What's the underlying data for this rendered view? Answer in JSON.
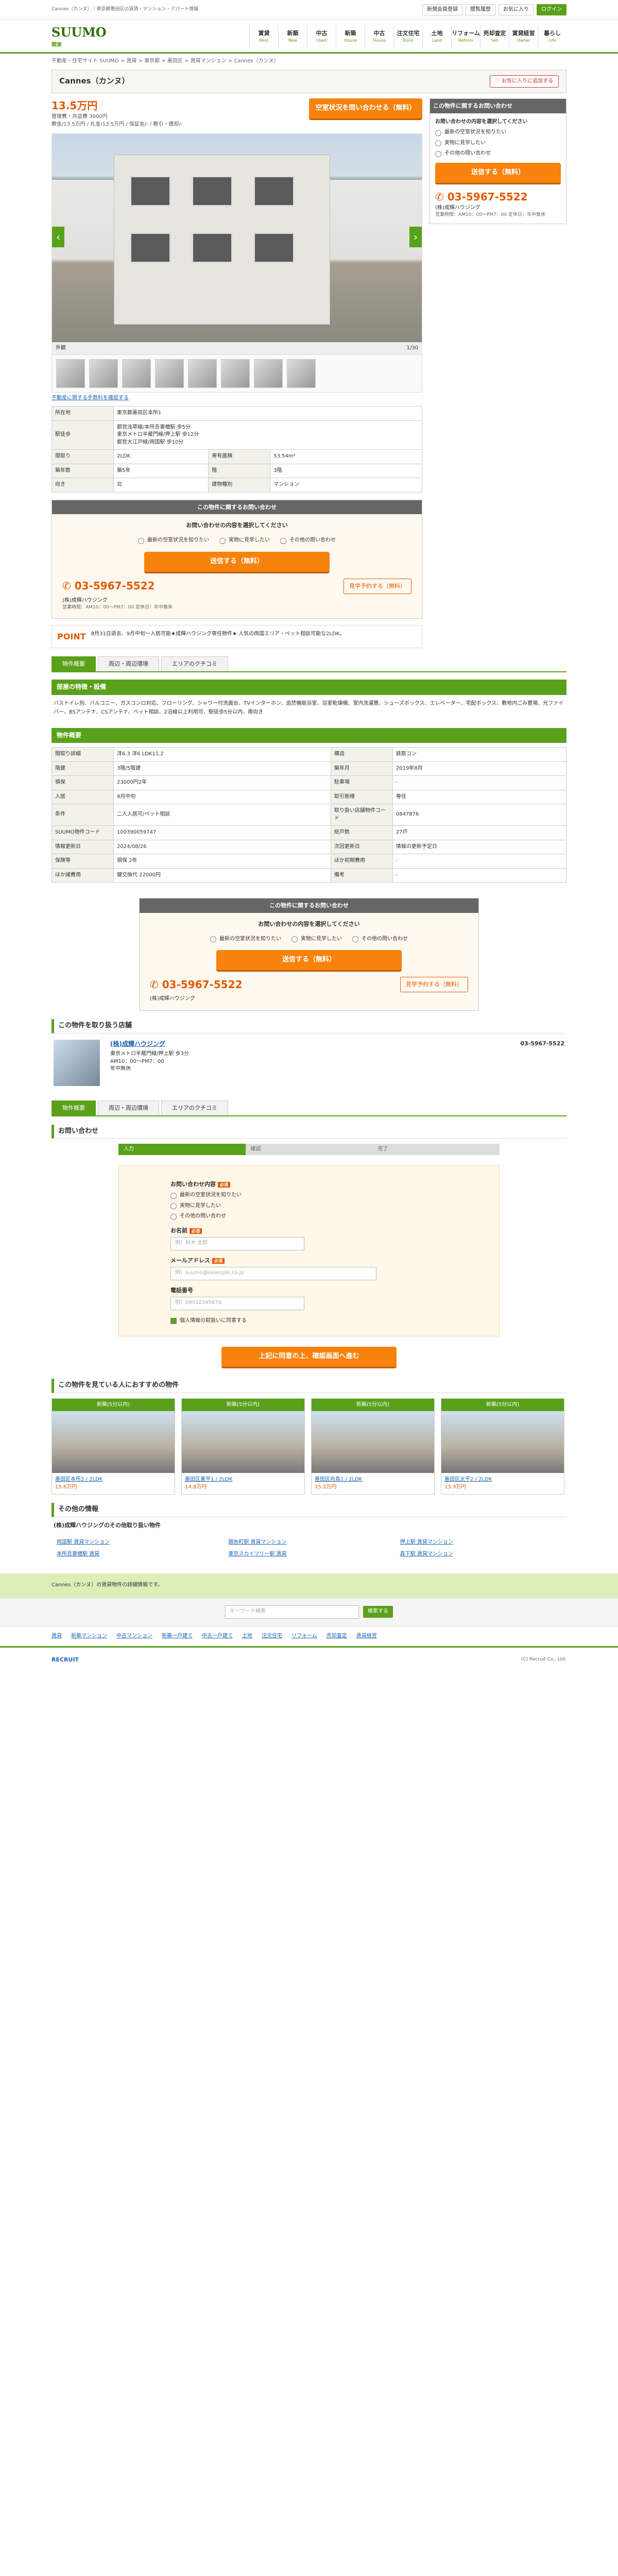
{
  "top": {
    "note": "Cannes（カンヌ）｜東京都墨田区の賃貸・マンション・アパート情報",
    "btns": [
      "新規会員登録",
      "ログイン",
      "閲覧履歴",
      "お気に入り",
      "メニュー"
    ]
  },
  "brand": {
    "name": "SUUMO",
    "region": "関東",
    "nav": [
      {
        "t": "賃貸",
        "s": "Rent"
      },
      {
        "t": "新築",
        "s": "New"
      },
      {
        "t": "中古",
        "s": "Used"
      },
      {
        "t": "新築",
        "s": "House"
      },
      {
        "t": "中古",
        "s": "House"
      },
      {
        "t": "注文住宅",
        "s": "Build"
      },
      {
        "t": "土地",
        "s": "Land"
      },
      {
        "t": "リフォーム",
        "s": "Reform"
      },
      {
        "t": "売却査定",
        "s": "Sell"
      },
      {
        "t": "賃貸経営",
        "s": "Owner"
      },
      {
        "t": "暮らし",
        "s": "Life"
      }
    ]
  },
  "breadcrumb": "不動産・住宅サイト SUUMO > 賃貸 > 東京都 > 墨田区 > 賃貸マンション > Cannes（カンヌ）",
  "title": "Cannes（カンヌ）",
  "fav_label": "お気に入りに追加する",
  "price": {
    "rent": "13.5万円",
    "fees": "管理費・共益費 3000円",
    "deposit": "敷金/13.5万円 / 礼金/13.5万円 / 保証金/- / 敷引・償却/-",
    "cta": "空室状況を問い合わせる（無料）"
  },
  "photo": {
    "caption": "外観",
    "count": "1/30"
  },
  "thumbs_note": "不動産に関する手数料を確認する",
  "details": [
    [
      "所在地",
      "東京都墨田区本所1"
    ],
    [
      "駅徒歩",
      "都営浅草線/本所吾妻橋駅 歩5分\n東京メトロ半蔵門線/押上駅 歩12分\n都営大江戸線/両国駅 歩10分"
    ],
    [
      "間取り",
      "2LDK"
    ],
    [
      "専有面積",
      "53.54m²"
    ],
    [
      "築年数",
      "築5年"
    ],
    [
      "階",
      "3階"
    ],
    [
      "向き",
      "北"
    ],
    [
      "建物種別",
      "マンション"
    ]
  ],
  "inquiry": {
    "head": "この物件に関するお問い合わせ",
    "prompt": "お問い合わせの内容を選択してください",
    "opts": [
      "最新の空室状況を知りたい",
      "実物に見学したい",
      "その他の問い合わせ"
    ],
    "send": "送信する（無料）",
    "tel": "03-5967-5522",
    "tel_btn": "見学予約する（無料）",
    "company": "(株)成輝ハウジング",
    "hours": "営業時間：AM10：00～PM7：00 定休日：年中無休"
  },
  "point": {
    "label": "POINT",
    "text": "8月31日退去、9月中旬〜入居可能★成輝ハウジング専任物件★ 人気の両国エリア・ペット相談可能な2LDK。"
  },
  "tabs": [
    "物件概要",
    "周辺・周辺環境",
    "エリアのクチコミ"
  ],
  "features": {
    "head": "部屋の特徴・設備",
    "text": "バストイレ別、バルコニー、ガスコンロ対応、フローリング、シャワー付洗面台、TVインターホン、追焚機能浴室、浴室乾燥機、室内洗濯置、シューズボックス、エレベーター、宅配ボックス、敷地内ごみ置場、光ファイバー、BSアンテナ、CSアンテナ、ペット相談、2沿線以上利用可、駅徒歩5分以内、南向き"
  },
  "overview": {
    "head": "物件概要",
    "rows": [
      [
        "間取り詳細",
        "洋6.3 洋6 LDK11.2",
        "構造",
        "鉄筋コン"
      ],
      [
        "階建",
        "3階/5階建",
        "築年月",
        "2019年8月"
      ],
      [
        "損保",
        "23000円2年",
        "駐車場",
        "-"
      ],
      [
        "入居",
        "9月中旬",
        "取引態様",
        "専任"
      ],
      [
        "条件",
        "二人入居可/ペット相談",
        "取り扱い店舗物件コード",
        "0847876"
      ],
      [
        "SUUMO物件コード",
        "100390059747",
        "総戸数",
        "27戸"
      ],
      [
        "情報更新日",
        "2024/08/26",
        "次回更新日",
        "情報の更新予定日"
      ],
      [
        "保険等",
        "損保 2年",
        "ほか初期費用",
        "-"
      ],
      [
        "ほか諸費用",
        "鍵交換代 22000円",
        "備考",
        "-"
      ]
    ]
  },
  "company_section": {
    "head": "この物件を取り扱う店舗",
    "name": "(株)成輝ハウジング",
    "addr": "東京メトロ半蔵門線/押上駅 歩3分",
    "hours": "AM10：00～PM7：00",
    "holiday": "年中無休",
    "tel": "03-5967-5522"
  },
  "form": {
    "head": "お問い合わせ",
    "steps": [
      "入力",
      "確認",
      "完了"
    ],
    "q": "お問い合わせ内容",
    "name_label": "お名前",
    "name_ph": "例）鈴木 太郎",
    "mail_label": "メールアドレス",
    "mail_ph": "例）suumo@example.co.jp",
    "tel_label": "電話番号",
    "tel_ph": "例）09012345678",
    "agree": "個人情報の取扱いに同意する",
    "submit": "上記に同意の上、確認画面へ進む"
  },
  "recs": {
    "head": "この物件を見ている人におすすめの物件",
    "items": [
      {
        "h": "新築(5分以内)",
        "n": "墨田区本所2 / 2LDK",
        "p": "15.6万円"
      },
      {
        "h": "新築(5分以内)",
        "n": "墨田区業平1 / 2LDK",
        "p": "14.8万円"
      },
      {
        "h": "新築(5分以内)",
        "n": "墨田区向島1 / 2LDK",
        "p": "15.2万円"
      },
      {
        "h": "新築(5分以内)",
        "n": "墨田区太平2 / 2LDK",
        "p": "13.9万円"
      }
    ]
  },
  "other": {
    "head": "その他の情報",
    "sub": "(株)成輝ハウジングのその他取り扱い物件",
    "links": [
      "両国駅 賃貸マンション",
      "錦糸町駅 賃貸マンション",
      "押上駅 賃貸マンション",
      "本所吾妻橋駅 賃貸",
      "東京スカイツリー駅 賃貸",
      "森下駅 賃貸マンション"
    ]
  },
  "footer": {
    "note": "Cannes（カンヌ）の賃貸物件の詳細情報です。",
    "search_ph": "キーワード検索",
    "search_btn": "検索する",
    "links": [
      "賃貸",
      "新築マンション",
      "中古マンション",
      "新築一戸建て",
      "中古一戸建て",
      "土地",
      "注文住宅",
      "リフォーム",
      "売却査定",
      "賃貸経営"
    ],
    "copy": "(C) Recruit Co., Ltd.",
    "brand": "RECRUIT"
  }
}
